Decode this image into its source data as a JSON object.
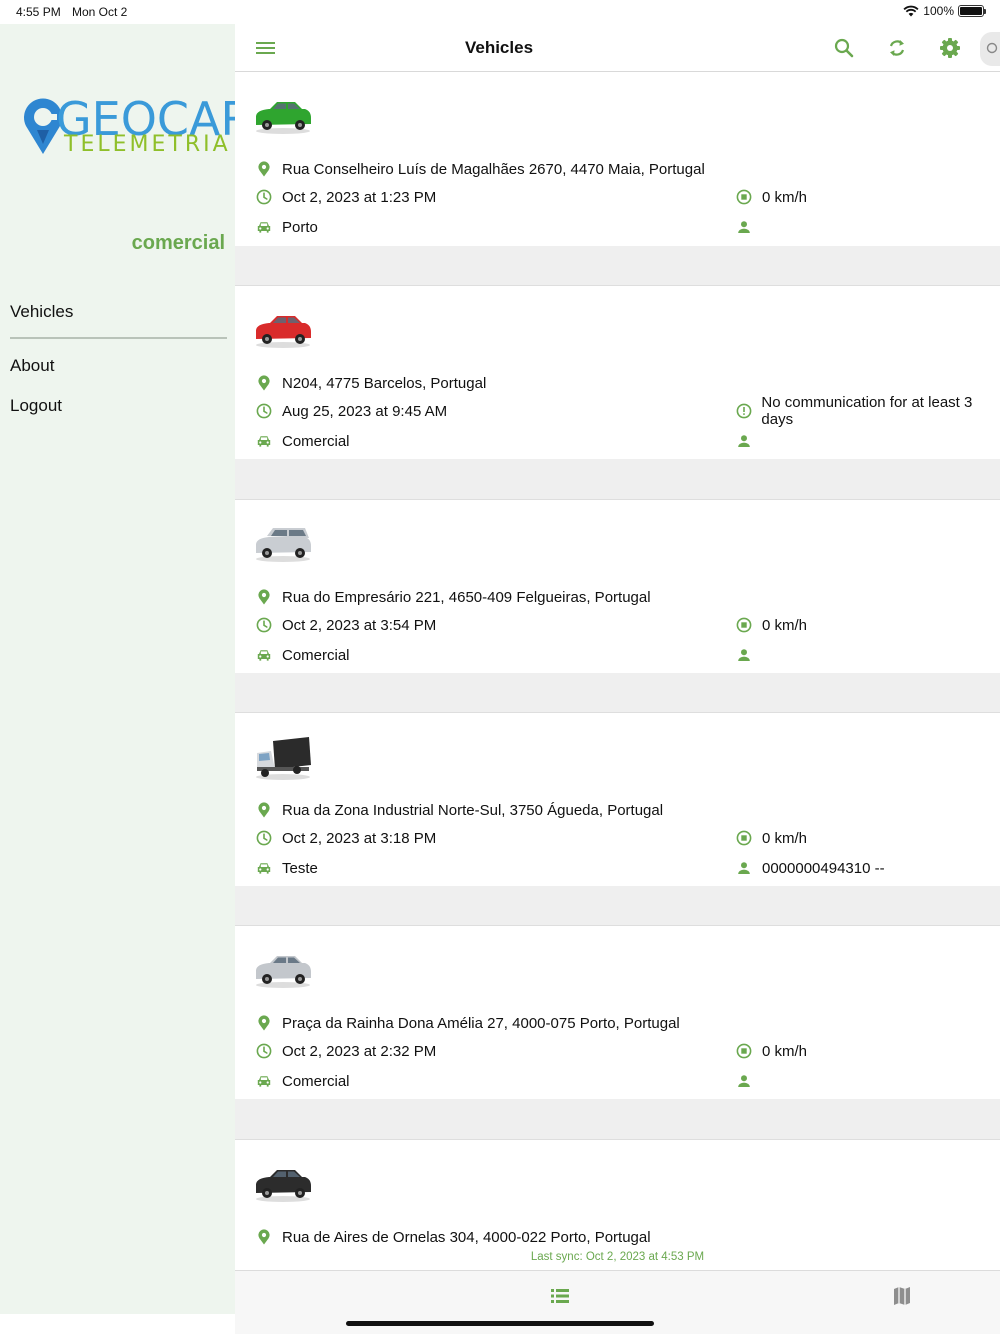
{
  "status_bar": {
    "time": "4:55 PM",
    "date": "Mon Oct 2",
    "battery": "100%"
  },
  "sidebar": {
    "logo_main": "GEOCAR",
    "logo_sub": "TELEMETRIA",
    "account": "comercial",
    "items": [
      {
        "label": "Vehicles"
      },
      {
        "label": "About"
      },
      {
        "label": "Logout"
      }
    ]
  },
  "header": {
    "title": "Vehicles",
    "icons": [
      "menu-icon",
      "search-icon",
      "refresh-icon",
      "gear-icon"
    ]
  },
  "colors": {
    "accent": "#6aa84f",
    "sidebar_bg": "#eef5ee",
    "separator": "#efefef"
  },
  "vehicles": [
    {
      "image": "green-car-icon",
      "address": "Rua Conselheiro Luís de Magalhães 2670, 4470 Maia, Portugal",
      "datetime": "Oct 2, 2023 at 1:23 PM",
      "status": "0 km/h",
      "status_icon": "stopped-icon",
      "group": "Porto",
      "driver": ""
    },
    {
      "image": "red-car-icon",
      "address": "N204, 4775 Barcelos, Portugal",
      "datetime": "Aug 25, 2023 at 9:45 AM",
      "status": "No communication for at least 3 days",
      "status_icon": "alert-icon",
      "group": "Comercial",
      "driver": ""
    },
    {
      "image": "silver-van-icon",
      "address": "Rua do Empresário 221, 4650-409 Felgueiras, Portugal",
      "datetime": "Oct 2, 2023 at 3:54 PM",
      "status": "0 km/h",
      "status_icon": "stopped-icon",
      "group": "Comercial",
      "driver": ""
    },
    {
      "image": "truck-icon",
      "address": "Rua da Zona Industrial Norte-Sul, 3750 Águeda, Portugal",
      "datetime": "Oct 2, 2023 at 3:18 PM",
      "status": "0 km/h",
      "status_icon": "stopped-icon",
      "group": "Teste",
      "driver": "0000000494310 --"
    },
    {
      "image": "silver-car-icon",
      "address": "Praça da Rainha Dona Amélia 27, 4000-075 Porto, Portugal",
      "datetime": "Oct 2, 2023 at 2:32 PM",
      "status": "0 km/h",
      "status_icon": "stopped-icon",
      "group": "Comercial",
      "driver": ""
    },
    {
      "image": "black-car-icon",
      "address": "Rua de Aires de Ornelas 304, 4000-022 Porto, Portugal"
    }
  ],
  "last_sync": "Last sync:  Oct 2, 2023 at 4:53 PM",
  "tabbar": {
    "tabs": [
      "list-icon",
      "map-icon"
    ]
  }
}
